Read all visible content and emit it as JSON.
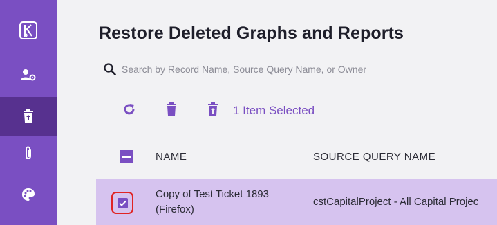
{
  "sidebar": {
    "items": [
      {
        "icon": "k-logo-icon",
        "active": false
      },
      {
        "icon": "user-settings-icon",
        "active": false
      },
      {
        "icon": "trash-restore-icon",
        "active": true
      },
      {
        "icon": "paperclip-icon",
        "active": false
      },
      {
        "icon": "palette-icon",
        "active": false
      }
    ],
    "accent": "#7a4fc2",
    "active_bg": "#57318f"
  },
  "page": {
    "title": "Restore Deleted Graphs and Reports"
  },
  "search": {
    "placeholder": "Search by Record Name, Source Query Name, or Owner",
    "value": ""
  },
  "toolbar": {
    "refresh_icon": "refresh-icon",
    "delete_icon": "trash-icon",
    "restore_icon": "restore-icon",
    "selected_text": "1 Item Selected"
  },
  "table": {
    "columns": [
      "NAME",
      "SOURCE QUERY NAME"
    ],
    "rows": [
      {
        "selected": true,
        "name": "Copy of Test Ticket 1893 (Firefox)",
        "source_query": "cstCapitalProject - All Capital Projec"
      }
    ]
  },
  "colors": {
    "brand": "#7a4fc2",
    "row_highlight": "#d6c3ef",
    "annotation_ring": "#e02424"
  }
}
